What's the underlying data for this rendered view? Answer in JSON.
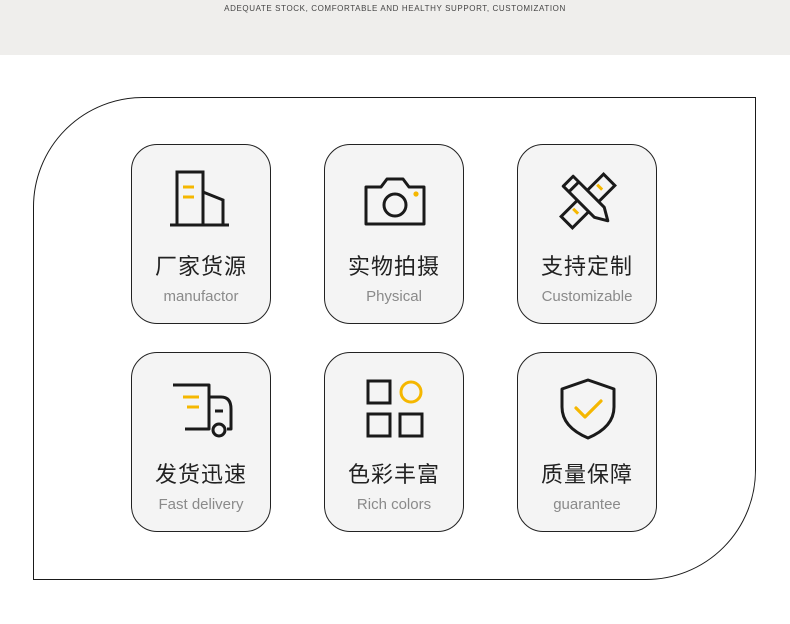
{
  "header": {
    "tagline": "ADEQUATE STOCK, COMFORTABLE AND HEALTHY SUPPORT, CUSTOMIZATION"
  },
  "accent_color": "#f5b700",
  "stroke_color": "#1a1a1a",
  "features": [
    {
      "cn": "厂家货源",
      "en": "manufactor",
      "icon": "factory-building-icon"
    },
    {
      "cn": "实物拍摄",
      "en": "Physical",
      "icon": "camera-icon"
    },
    {
      "cn": "支持定制",
      "en": "Customizable",
      "icon": "pencil-ruler-icon"
    },
    {
      "cn": "发货迅速",
      "en": "Fast delivery",
      "icon": "delivery-truck-icon"
    },
    {
      "cn": "色彩丰富",
      "en": "Rich colors",
      "icon": "color-grid-icon"
    },
    {
      "cn": "质量保障",
      "en": "guarantee",
      "icon": "shield-check-icon"
    }
  ]
}
